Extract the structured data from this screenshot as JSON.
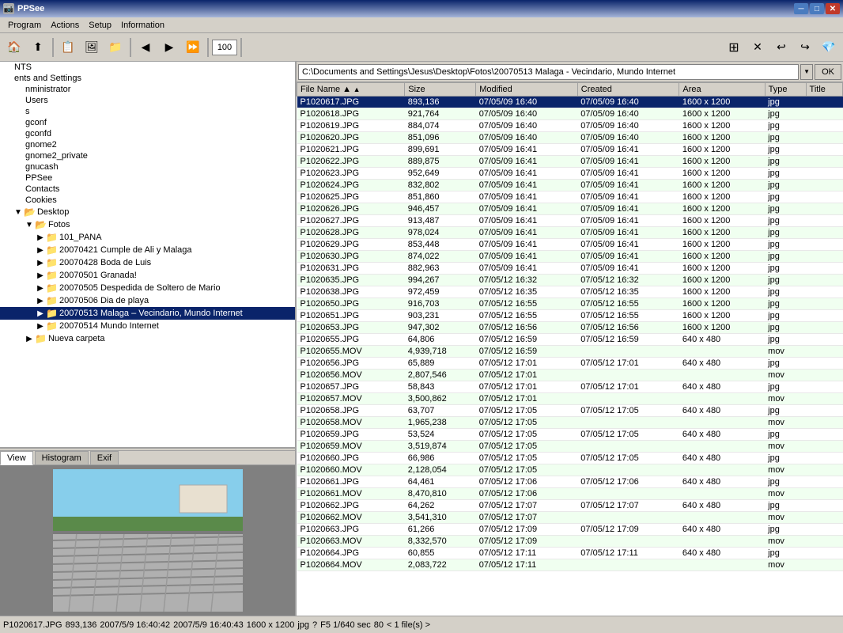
{
  "app": {
    "title": "PPSee",
    "icon": "📷"
  },
  "titlebar": {
    "title": "PPSee",
    "minimize_label": "─",
    "maximize_label": "□",
    "close_label": "✕"
  },
  "menubar": {
    "items": [
      {
        "label": "Program",
        "id": "program"
      },
      {
        "label": "Actions",
        "id": "actions"
      },
      {
        "label": "Setup",
        "id": "setup"
      },
      {
        "label": "Information",
        "id": "information"
      }
    ]
  },
  "toolbar": {
    "zoom_value": "100",
    "buttons": [
      {
        "id": "home",
        "icon": "🏠",
        "label": "Home"
      },
      {
        "id": "up",
        "icon": "⬆",
        "label": "Up"
      },
      {
        "id": "copy",
        "icon": "📋",
        "label": "Copy"
      },
      {
        "id": "view",
        "icon": "🖼",
        "label": "View"
      },
      {
        "id": "folder",
        "icon": "📁",
        "label": "Folder"
      },
      {
        "id": "prev",
        "icon": "◀",
        "label": "Previous"
      },
      {
        "id": "next",
        "icon": "▶",
        "label": "Next"
      },
      {
        "id": "fwd",
        "icon": "⏩",
        "label": "Forward"
      }
    ]
  },
  "address_bar": {
    "path": "C:\\Documents and Settings\\Jesus\\Desktop\\Fotos\\20070513 Malaga - Vecindario, Mundo Internet",
    "ok_label": "OK"
  },
  "tree": {
    "items": [
      {
        "indent": 0,
        "label": "NTS",
        "expanded": false,
        "is_folder": false
      },
      {
        "indent": 0,
        "label": "ents and Settings",
        "expanded": false,
        "is_folder": false
      },
      {
        "indent": 1,
        "label": "nministrator",
        "expanded": false,
        "is_folder": false
      },
      {
        "indent": 1,
        "label": "Users",
        "expanded": false,
        "is_folder": false
      },
      {
        "indent": 1,
        "label": "s",
        "expanded": false,
        "is_folder": false
      },
      {
        "indent": 1,
        "label": "gconf",
        "expanded": false,
        "is_folder": false
      },
      {
        "indent": 1,
        "label": "gconfd",
        "expanded": false,
        "is_folder": false
      },
      {
        "indent": 1,
        "label": "gnome2",
        "expanded": false,
        "is_folder": false
      },
      {
        "indent": 1,
        "label": "gnome2_private",
        "expanded": false,
        "is_folder": false
      },
      {
        "indent": 1,
        "label": "gnucash",
        "expanded": false,
        "is_folder": false
      },
      {
        "indent": 1,
        "label": "PPSee",
        "expanded": false,
        "is_folder": false
      },
      {
        "indent": 1,
        "label": "Contacts",
        "expanded": false,
        "is_folder": false
      },
      {
        "indent": 1,
        "label": "Cookies",
        "expanded": false,
        "is_folder": false
      },
      {
        "indent": 1,
        "label": "Desktop",
        "expanded": true,
        "is_folder": true
      },
      {
        "indent": 2,
        "label": "Fotos",
        "expanded": true,
        "is_folder": true
      },
      {
        "indent": 3,
        "label": "101_PANA",
        "expanded": false,
        "is_folder": true
      },
      {
        "indent": 3,
        "label": "20070421 Cumple de Ali y Malaga",
        "expanded": false,
        "is_folder": true
      },
      {
        "indent": 3,
        "label": "20070428 Boda de Luis",
        "expanded": false,
        "is_folder": true
      },
      {
        "indent": 3,
        "label": "20070501 Granada!",
        "expanded": false,
        "is_folder": true
      },
      {
        "indent": 3,
        "label": "20070505 Despedida de Soltero de Mario",
        "expanded": false,
        "is_folder": true
      },
      {
        "indent": 3,
        "label": "20070506 Dia de playa",
        "expanded": false,
        "is_folder": true
      },
      {
        "indent": 3,
        "label": "20070513 Malaga – Vecindario, Mundo Internet",
        "expanded": false,
        "is_folder": true,
        "selected": true
      },
      {
        "indent": 3,
        "label": "20070514 Mundo Internet",
        "expanded": false,
        "is_folder": true
      },
      {
        "indent": 2,
        "label": "Nueva carpeta",
        "expanded": false,
        "is_folder": true
      }
    ]
  },
  "tabs": [
    {
      "label": "View",
      "active": true
    },
    {
      "label": "Histogram",
      "active": false
    },
    {
      "label": "Exif",
      "active": false
    }
  ],
  "file_columns": [
    {
      "label": "File Name",
      "id": "name",
      "sorted": true
    },
    {
      "label": "Size",
      "id": "size"
    },
    {
      "label": "Modified",
      "id": "modified"
    },
    {
      "label": "Created",
      "id": "created"
    },
    {
      "label": "Area",
      "id": "area"
    },
    {
      "label": "Type",
      "id": "type"
    },
    {
      "label": "Title",
      "id": "title"
    }
  ],
  "files": [
    {
      "name": "P1020617.JPG",
      "size": "893,136",
      "modified": "07/05/09 16:40",
      "created": "07/05/09 16:40",
      "area": "1600 x 1200",
      "type": "jpg",
      "title": ""
    },
    {
      "name": "P1020618.JPG",
      "size": "921,764",
      "modified": "07/05/09 16:40",
      "created": "07/05/09 16:40",
      "area": "1600 x 1200",
      "type": "jpg",
      "title": ""
    },
    {
      "name": "P1020619.JPG",
      "size": "884,074",
      "modified": "07/05/09 16:40",
      "created": "07/05/09 16:40",
      "area": "1600 x 1200",
      "type": "jpg",
      "title": ""
    },
    {
      "name": "P1020620.JPG",
      "size": "851,096",
      "modified": "07/05/09 16:40",
      "created": "07/05/09 16:40",
      "area": "1600 x 1200",
      "type": "jpg",
      "title": ""
    },
    {
      "name": "P1020621.JPG",
      "size": "899,691",
      "modified": "07/05/09 16:41",
      "created": "07/05/09 16:41",
      "area": "1600 x 1200",
      "type": "jpg",
      "title": ""
    },
    {
      "name": "P1020622.JPG",
      "size": "889,875",
      "modified": "07/05/09 16:41",
      "created": "07/05/09 16:41",
      "area": "1600 x 1200",
      "type": "jpg",
      "title": ""
    },
    {
      "name": "P1020623.JPG",
      "size": "952,649",
      "modified": "07/05/09 16:41",
      "created": "07/05/09 16:41",
      "area": "1600 x 1200",
      "type": "jpg",
      "title": ""
    },
    {
      "name": "P1020624.JPG",
      "size": "832,802",
      "modified": "07/05/09 16:41",
      "created": "07/05/09 16:41",
      "area": "1600 x 1200",
      "type": "jpg",
      "title": ""
    },
    {
      "name": "P1020625.JPG",
      "size": "851,860",
      "modified": "07/05/09 16:41",
      "created": "07/05/09 16:41",
      "area": "1600 x 1200",
      "type": "jpg",
      "title": ""
    },
    {
      "name": "P1020626.JPG",
      "size": "946,457",
      "modified": "07/05/09 16:41",
      "created": "07/05/09 16:41",
      "area": "1600 x 1200",
      "type": "jpg",
      "title": ""
    },
    {
      "name": "P1020627.JPG",
      "size": "913,487",
      "modified": "07/05/09 16:41",
      "created": "07/05/09 16:41",
      "area": "1600 x 1200",
      "type": "jpg",
      "title": ""
    },
    {
      "name": "P1020628.JPG",
      "size": "978,024",
      "modified": "07/05/09 16:41",
      "created": "07/05/09 16:41",
      "area": "1600 x 1200",
      "type": "jpg",
      "title": ""
    },
    {
      "name": "P1020629.JPG",
      "size": "853,448",
      "modified": "07/05/09 16:41",
      "created": "07/05/09 16:41",
      "area": "1600 x 1200",
      "type": "jpg",
      "title": ""
    },
    {
      "name": "P1020630.JPG",
      "size": "874,022",
      "modified": "07/05/09 16:41",
      "created": "07/05/09 16:41",
      "area": "1600 x 1200",
      "type": "jpg",
      "title": ""
    },
    {
      "name": "P1020631.JPG",
      "size": "882,963",
      "modified": "07/05/09 16:41",
      "created": "07/05/09 16:41",
      "area": "1600 x 1200",
      "type": "jpg",
      "title": ""
    },
    {
      "name": "P1020635.JPG",
      "size": "994,267",
      "modified": "07/05/12 16:32",
      "created": "07/05/12 16:32",
      "area": "1600 x 1200",
      "type": "jpg",
      "title": ""
    },
    {
      "name": "P1020638.JPG",
      "size": "972,459",
      "modified": "07/05/12 16:35",
      "created": "07/05/12 16:35",
      "area": "1600 x 1200",
      "type": "jpg",
      "title": ""
    },
    {
      "name": "P1020650.JPG",
      "size": "916,703",
      "modified": "07/05/12 16:55",
      "created": "07/05/12 16:55",
      "area": "1600 x 1200",
      "type": "jpg",
      "title": ""
    },
    {
      "name": "P1020651.JPG",
      "size": "903,231",
      "modified": "07/05/12 16:55",
      "created": "07/05/12 16:55",
      "area": "1600 x 1200",
      "type": "jpg",
      "title": ""
    },
    {
      "name": "P1020653.JPG",
      "size": "947,302",
      "modified": "07/05/12 16:56",
      "created": "07/05/12 16:56",
      "area": "1600 x 1200",
      "type": "jpg",
      "title": ""
    },
    {
      "name": "P1020655.JPG",
      "size": "64,806",
      "modified": "07/05/12 16:59",
      "created": "07/05/12 16:59",
      "area": "640 x 480",
      "type": "jpg",
      "title": ""
    },
    {
      "name": "P1020655.MOV",
      "size": "4,939,718",
      "modified": "07/05/12 16:59",
      "created": "",
      "area": "",
      "type": "mov",
      "title": ""
    },
    {
      "name": "P1020656.JPG",
      "size": "65,889",
      "modified": "07/05/12 17:01",
      "created": "07/05/12 17:01",
      "area": "640 x 480",
      "type": "jpg",
      "title": ""
    },
    {
      "name": "P1020656.MOV",
      "size": "2,807,546",
      "modified": "07/05/12 17:01",
      "created": "",
      "area": "",
      "type": "mov",
      "title": ""
    },
    {
      "name": "P1020657.JPG",
      "size": "58,843",
      "modified": "07/05/12 17:01",
      "created": "07/05/12 17:01",
      "area": "640 x 480",
      "type": "jpg",
      "title": ""
    },
    {
      "name": "P1020657.MOV",
      "size": "3,500,862",
      "modified": "07/05/12 17:01",
      "created": "",
      "area": "",
      "type": "mov",
      "title": ""
    },
    {
      "name": "P1020658.JPG",
      "size": "63,707",
      "modified": "07/05/12 17:05",
      "created": "07/05/12 17:05",
      "area": "640 x 480",
      "type": "jpg",
      "title": ""
    },
    {
      "name": "P1020658.MOV",
      "size": "1,965,238",
      "modified": "07/05/12 17:05",
      "created": "",
      "area": "",
      "type": "mov",
      "title": ""
    },
    {
      "name": "P1020659.JPG",
      "size": "53,524",
      "modified": "07/05/12 17:05",
      "created": "07/05/12 17:05",
      "area": "640 x 480",
      "type": "jpg",
      "title": ""
    },
    {
      "name": "P1020659.MOV",
      "size": "3,519,874",
      "modified": "07/05/12 17:05",
      "created": "",
      "area": "",
      "type": "mov",
      "title": ""
    },
    {
      "name": "P1020660.JPG",
      "size": "66,986",
      "modified": "07/05/12 17:05",
      "created": "07/05/12 17:05",
      "area": "640 x 480",
      "type": "jpg",
      "title": ""
    },
    {
      "name": "P1020660.MOV",
      "size": "2,128,054",
      "modified": "07/05/12 17:05",
      "created": "",
      "area": "",
      "type": "mov",
      "title": ""
    },
    {
      "name": "P1020661.JPG",
      "size": "64,461",
      "modified": "07/05/12 17:06",
      "created": "07/05/12 17:06",
      "area": "640 x 480",
      "type": "jpg",
      "title": ""
    },
    {
      "name": "P1020661.MOV",
      "size": "8,470,810",
      "modified": "07/05/12 17:06",
      "created": "",
      "area": "",
      "type": "mov",
      "title": ""
    },
    {
      "name": "P1020662.JPG",
      "size": "64,262",
      "modified": "07/05/12 17:07",
      "created": "07/05/12 17:07",
      "area": "640 x 480",
      "type": "jpg",
      "title": ""
    },
    {
      "name": "P1020662.MOV",
      "size": "3,541,310",
      "modified": "07/05/12 17:07",
      "created": "",
      "area": "",
      "type": "mov",
      "title": ""
    },
    {
      "name": "P1020663.JPG",
      "size": "61,266",
      "modified": "07/05/12 17:09",
      "created": "07/05/12 17:09",
      "area": "640 x 480",
      "type": "jpg",
      "title": ""
    },
    {
      "name": "P1020663.MOV",
      "size": "8,332,570",
      "modified": "07/05/12 17:09",
      "created": "",
      "area": "",
      "type": "mov",
      "title": ""
    },
    {
      "name": "P1020664.JPG",
      "size": "60,855",
      "modified": "07/05/12 17:11",
      "created": "07/05/12 17:11",
      "area": "640 x 480",
      "type": "jpg",
      "title": ""
    },
    {
      "name": "P1020664.MOV",
      "size": "2,083,722",
      "modified": "07/05/12 17:11",
      "created": "",
      "area": "",
      "type": "mov",
      "title": ""
    }
  ],
  "statusbar": {
    "filename": "P1020617.JPG",
    "size": "893,136",
    "date1": "2007/5/9 16:40:42",
    "date2": "2007/5/9 16:40:43",
    "dimensions": "1600 x 1200",
    "type": "jpg",
    "key": "?",
    "exposure": "F5  1/640 sec",
    "quality": "80",
    "count": "< 1 file(s) >"
  }
}
